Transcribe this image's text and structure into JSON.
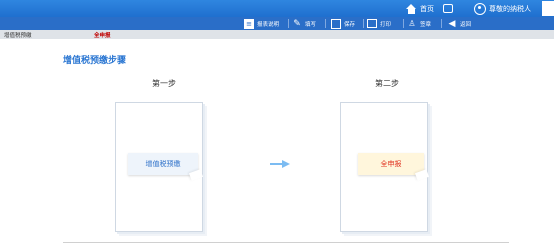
{
  "header": {
    "home": "首页",
    "user": "尊敬的纳税人"
  },
  "toolbar": {
    "items": [
      {
        "icon": "report-description-icon",
        "label": "报表说明"
      },
      {
        "icon": "pencil-icon",
        "label": "填写"
      },
      {
        "icon": "save-icon",
        "label": "保存"
      },
      {
        "icon": "print-icon",
        "label": "打印"
      },
      {
        "icon": "sign-icon",
        "label": "签章"
      },
      {
        "icon": "back-arrow-icon",
        "label": "返回"
      }
    ]
  },
  "tabbar": {
    "left": "增值税预缴",
    "right": "全申报"
  },
  "main": {
    "title": "增值税预缴步骤",
    "step1": {
      "label": "第一步",
      "button": "增值税预缴"
    },
    "step2": {
      "label": "第二步",
      "button": "全申报"
    }
  },
  "colors": {
    "accent": "#2a76d2",
    "toolbar": "#2a6ec8",
    "highlight": "#e0301e"
  }
}
